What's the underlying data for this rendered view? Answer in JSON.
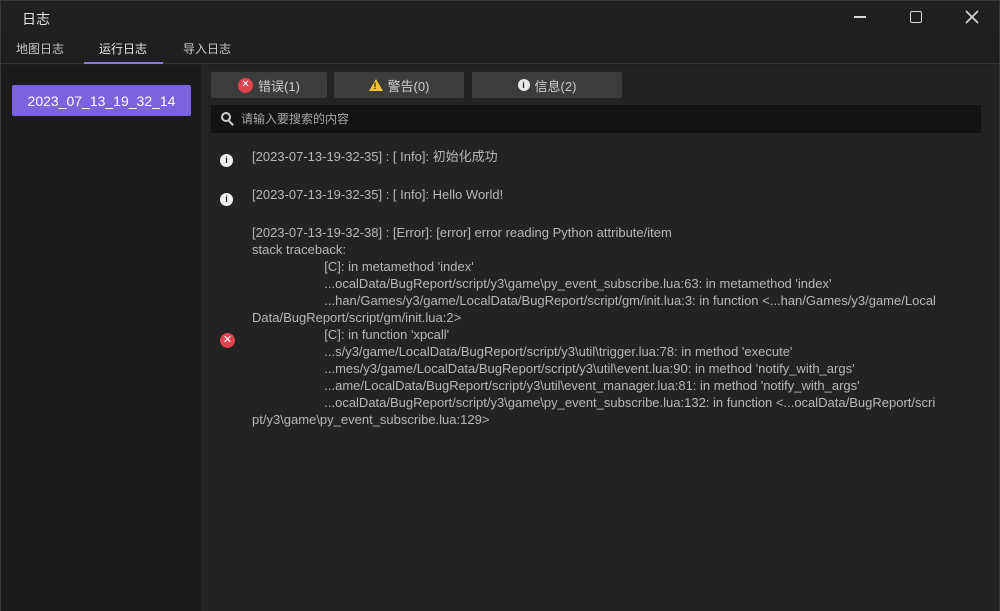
{
  "window": {
    "title": "日志"
  },
  "tabs": [
    {
      "label": "地图日志"
    },
    {
      "label": "运行日志"
    },
    {
      "label": "导入日志"
    }
  ],
  "sidebar": {
    "items": [
      {
        "label": "2023_07_13_19_32_14"
      }
    ]
  },
  "filters": {
    "error_label": "错误(1)",
    "warning_label": "警告(0)",
    "info_label": "信息(2)"
  },
  "search": {
    "placeholder": "请输入要搜索的内容"
  },
  "logs": [
    {
      "level": "info",
      "text": "[2023-07-13-19-32-35] : [ Info]: 初始化成功"
    },
    {
      "level": "info",
      "text": "[2023-07-13-19-32-35] : [ Info]: Hello World!"
    },
    {
      "level": "error",
      "text": "[2023-07-13-19-32-38] : [Error]: [error] error reading Python attribute/item\nstack traceback:\n                    [C]: in metamethod 'index'\n                    ...ocalData/BugReport/script/y3\\game\\py_event_subscribe.lua:63: in metamethod 'index'\n                    ...han/Games/y3/game/LocalData/BugReport/script/gm/init.lua:3: in function <...han/Games/y3/game/LocalData/BugReport/script/gm/init.lua:2>\n                    [C]: in function 'xpcall'\n                    ...s/y3/game/LocalData/BugReport/script/y3\\util\\trigger.lua:78: in method 'execute'\n                    ...mes/y3/game/LocalData/BugReport/script/y3\\util\\event.lua:90: in method 'notify_with_args'\n                    ...ame/LocalData/BugReport/script/y3\\util\\event_manager.lua:81: in method 'notify_with_args'\n                    ...ocalData/BugReport/script/y3\\game\\py_event_subscribe.lua:132: in function <...ocalData/BugReport/script/y3\\game\\py_event_subscribe.lua:129>"
    }
  ],
  "colors": {
    "accent": "#7b63e0",
    "error": "#e0444e",
    "warning": "#f1c232"
  }
}
